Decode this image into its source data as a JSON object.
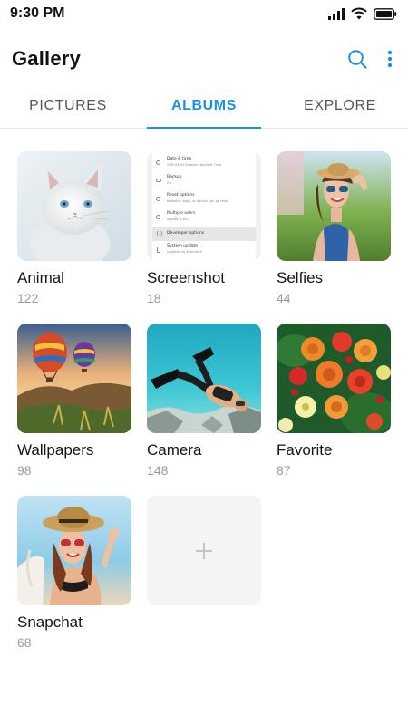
{
  "status": {
    "time": "9:30 PM"
  },
  "app": {
    "title": "Gallery"
  },
  "tabs": [
    {
      "label": "PICTURES"
    },
    {
      "label": "ALBUMS",
      "active": true
    },
    {
      "label": "EXPLORE"
    }
  ],
  "screenshot_thumb": {
    "rows": [
      {
        "title": "Date & time",
        "sub": "GMT-04:00 Eastern Daylight Time"
      },
      {
        "title": "Backup",
        "sub": "On"
      },
      {
        "title": "Reset options",
        "sub": "Network, apps, or device can be reset"
      },
      {
        "title": "Multiple users",
        "sub": "Signed in as J"
      },
      {
        "title": "Developer options",
        "sub": ""
      },
      {
        "title": "System update",
        "sub": "Updated to Android 9"
      }
    ]
  },
  "albums": [
    {
      "name": "Animal",
      "count": "122",
      "icon": "cat-photo"
    },
    {
      "name": "Screenshot",
      "count": "18",
      "icon": "settings-screenshot"
    },
    {
      "name": "Selfies",
      "count": "44",
      "icon": "woman-photo"
    },
    {
      "name": "Wallpapers",
      "count": "98",
      "icon": "balloons-photo"
    },
    {
      "name": "Camera",
      "count": "148",
      "icon": "diver-photo"
    },
    {
      "name": "Favorite",
      "count": "87",
      "icon": "flowers-photo"
    },
    {
      "name": "Snapchat",
      "count": "68",
      "icon": "hat-woman-photo"
    }
  ],
  "colors": {
    "accent": "#1d8fe6",
    "add_tile": "#f4f4f4"
  }
}
